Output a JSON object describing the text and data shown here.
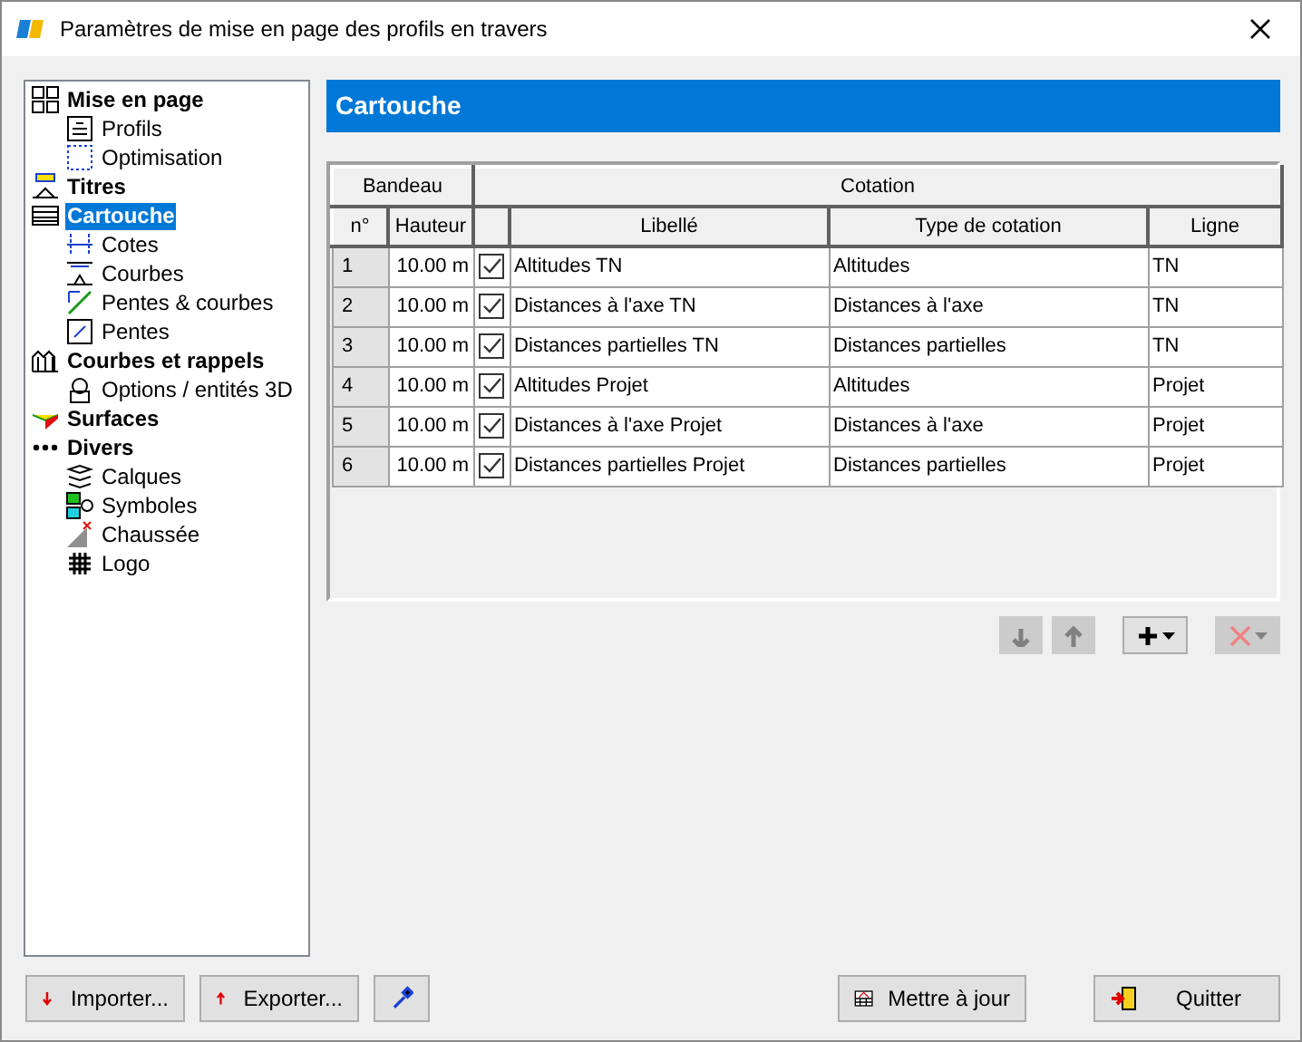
{
  "window": {
    "title": "Paramètres de mise en page des profils en travers"
  },
  "tree": [
    {
      "label": "Mise en page",
      "selected": false,
      "children": [
        {
          "label": "Profils",
          "selected": false
        },
        {
          "label": "Optimisation",
          "selected": false
        }
      ]
    },
    {
      "label": "Titres",
      "selected": false
    },
    {
      "label": "Cartouche",
      "selected": true,
      "children": [
        {
          "label": "Cotes",
          "selected": false
        },
        {
          "label": "Courbes",
          "selected": false
        },
        {
          "label": "Pentes & courbes",
          "selected": false
        },
        {
          "label": "Pentes",
          "selected": false
        }
      ]
    },
    {
      "label": "Courbes et rappels",
      "selected": false,
      "children": [
        {
          "label": "Options / entités 3D",
          "selected": false
        }
      ]
    },
    {
      "label": "Surfaces",
      "selected": false
    },
    {
      "label": "Divers",
      "selected": false,
      "children": [
        {
          "label": "Calques",
          "selected": false
        },
        {
          "label": "Symboles",
          "selected": false
        },
        {
          "label": "Chaussée",
          "selected": false
        },
        {
          "label": "Logo",
          "selected": false
        }
      ]
    }
  ],
  "panel": {
    "title": "Cartouche"
  },
  "table": {
    "groups": [
      "Bandeau",
      "Cotation"
    ],
    "columns": [
      "n°",
      "Hauteur",
      "",
      "Libellé",
      "Type de cotation",
      "Ligne"
    ],
    "rows": [
      {
        "n": "1",
        "hauteur": "10.00 m",
        "checked": true,
        "libelle": "Altitudes TN",
        "type": "Altitudes",
        "ligne": "TN"
      },
      {
        "n": "2",
        "hauteur": "10.00 m",
        "checked": true,
        "libelle": "Distances à l'axe TN",
        "type": "Distances à l'axe",
        "ligne": "TN"
      },
      {
        "n": "3",
        "hauteur": "10.00 m",
        "checked": true,
        "libelle": "Distances partielles TN",
        "type": "Distances partielles",
        "ligne": "TN"
      },
      {
        "n": "4",
        "hauteur": "10.00 m",
        "checked": true,
        "libelle": "Altitudes Projet",
        "type": "Altitudes",
        "ligne": "Projet"
      },
      {
        "n": "5",
        "hauteur": "10.00 m",
        "checked": true,
        "libelle": "Distances à l'axe Projet",
        "type": "Distances à l'axe",
        "ligne": "Projet"
      },
      {
        "n": "6",
        "hauteur": "10.00 m",
        "checked": true,
        "libelle": "Distances partielles Projet",
        "type": "Distances partielles",
        "ligne": "Projet"
      }
    ]
  },
  "toolbar": [
    {
      "kind": "down",
      "disabled": true
    },
    {
      "kind": "up",
      "disabled": true
    },
    {
      "kind": "add",
      "disabled": false
    },
    {
      "kind": "delete",
      "disabled": true
    }
  ],
  "buttons": [
    {
      "kind": "import",
      "label": "Importer..."
    },
    {
      "kind": "export",
      "label": "Exporter..."
    },
    {
      "kind": "picker"
    },
    {
      "kind": "update",
      "label": "Mettre à jour"
    },
    {
      "kind": "quit",
      "label": "Quitter"
    }
  ]
}
